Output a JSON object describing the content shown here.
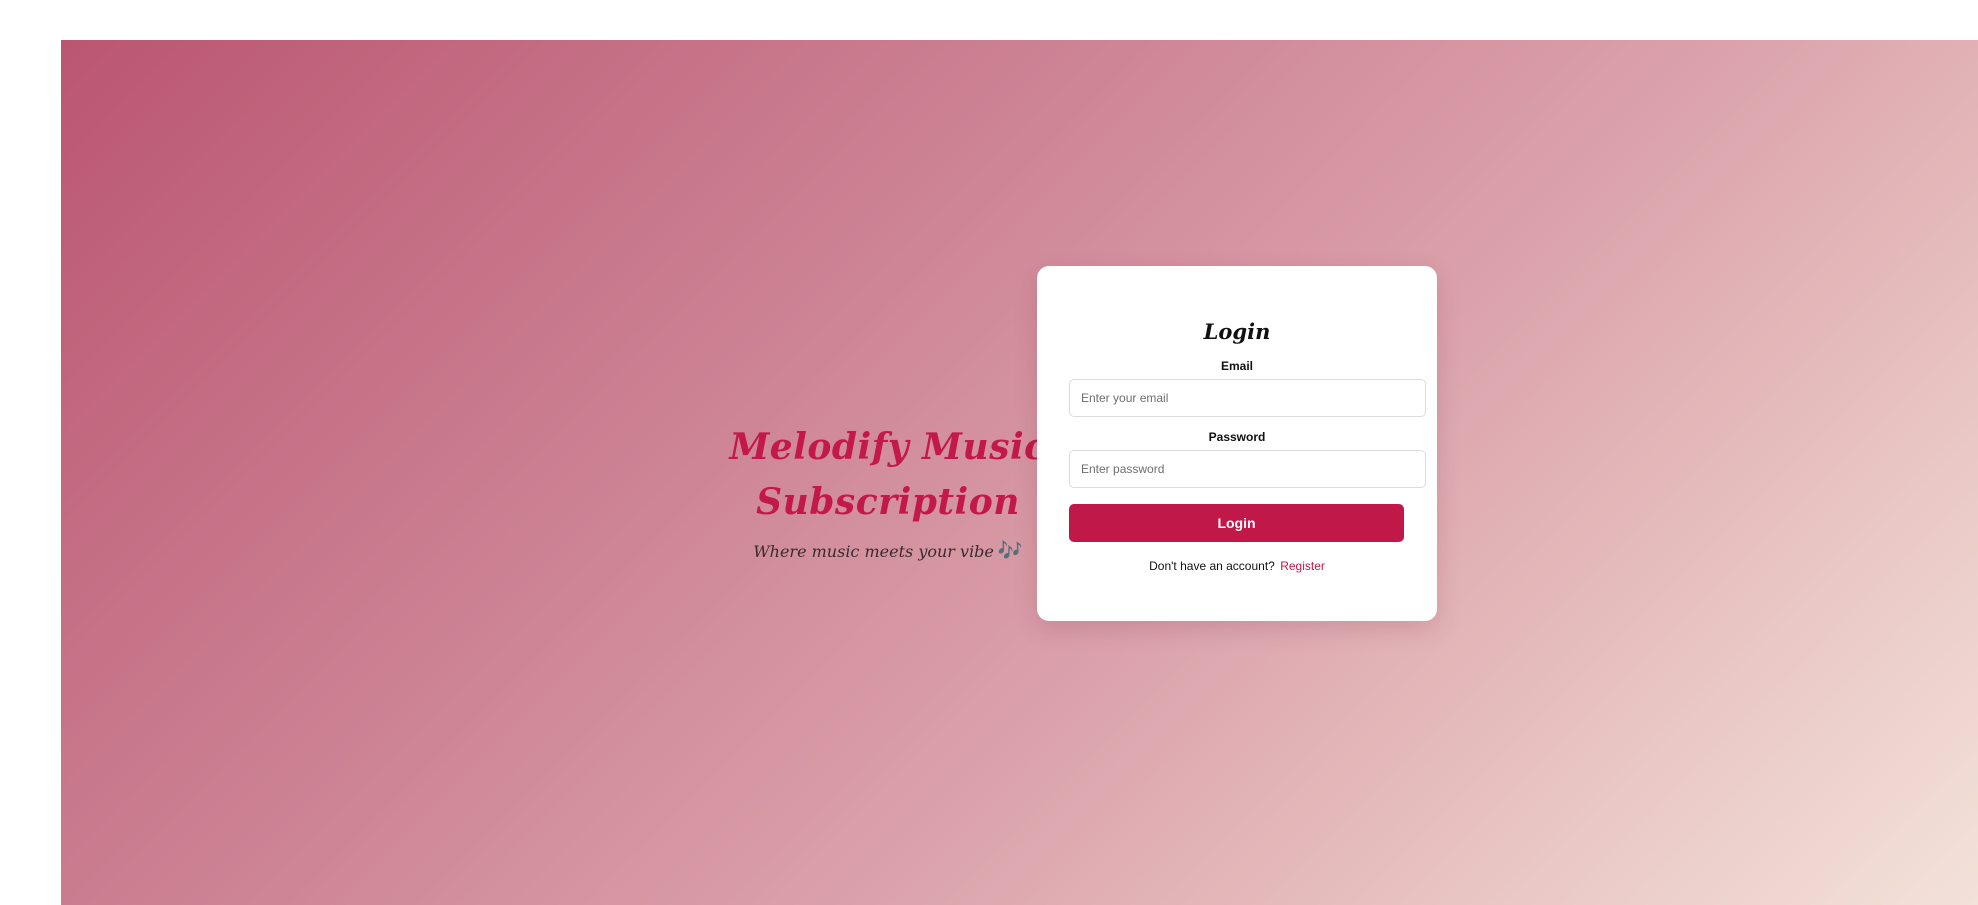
{
  "brand": {
    "title": "Melodify Music Subscription",
    "tagline": "Where music meets your vibe",
    "tagline_icon": "🎶"
  },
  "login_form": {
    "title": "Login",
    "email_label": "Email",
    "email_placeholder": "Enter your email",
    "email_value": "",
    "password_label": "Password",
    "password_placeholder": "Enter password",
    "password_value": "",
    "submit_label": "Login",
    "register_prompt": "Don't have an account?",
    "register_link": "Register"
  },
  "colors": {
    "accent": "#c01848",
    "brand_title": "#c2184a",
    "gradient_start": "#bb5672",
    "gradient_end": "#f3e2d9"
  }
}
